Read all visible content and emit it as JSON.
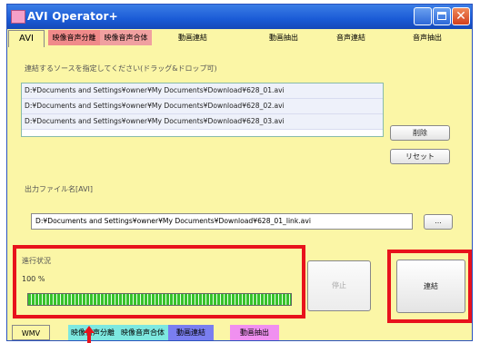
{
  "window": {
    "title": "AVI Operator+"
  },
  "tabs_top": [
    {
      "label": "AVI",
      "bg": "#fbf6a6"
    },
    {
      "label": "映像音声分離",
      "bg": "#f08a8a"
    },
    {
      "label": "映像音声合体",
      "bg": "#f0a0a0"
    },
    {
      "label": "動画連結",
      "bg": "#fbf6a6"
    },
    {
      "label": "動画抽出",
      "bg": "#fbf6a6"
    },
    {
      "label": "音声連結",
      "bg": "#fbf6a6"
    },
    {
      "label": "音声抽出",
      "bg": "#fbf6a6"
    }
  ],
  "sources": {
    "label": "連結するソースを指定してください(ドラッグ&ドロップ可)",
    "items": [
      "D:¥Documents and Settings¥owner¥My Documents¥Download¥628_01.avi",
      "D:¥Documents and Settings¥owner¥My Documents¥Download¥628_02.avi",
      "D:¥Documents and Settings¥owner¥My Documents¥Download¥628_03.avi"
    ],
    "delete_label": "削除",
    "reset_label": "リセット"
  },
  "output": {
    "label": "出力ファイル名[AVI]",
    "value": "D:¥Documents and Settings¥owner¥My Documents¥Download¥628_01_link.avi",
    "browse_label": "..."
  },
  "progress": {
    "label": "進行状況",
    "percent_text": "100 %",
    "fraction": 1.0
  },
  "actions": {
    "stop_label": "停止",
    "join_label": "連結"
  },
  "tabs_bottom": [
    {
      "label": "WMV",
      "bg": "#fbf6a6"
    },
    {
      "label": "映像音声分離",
      "bg": "#7de8e0"
    },
    {
      "label": "映像音声合体",
      "bg": "#7de8e0"
    },
    {
      "label": "動画連結",
      "bg": "#7a7ef0"
    },
    {
      "label": "動画抽出",
      "bg": "#f090f0"
    }
  ],
  "colors": {
    "highlight": "#e8121c",
    "panel": "#fbf6a6",
    "progress": "#37c22b"
  }
}
